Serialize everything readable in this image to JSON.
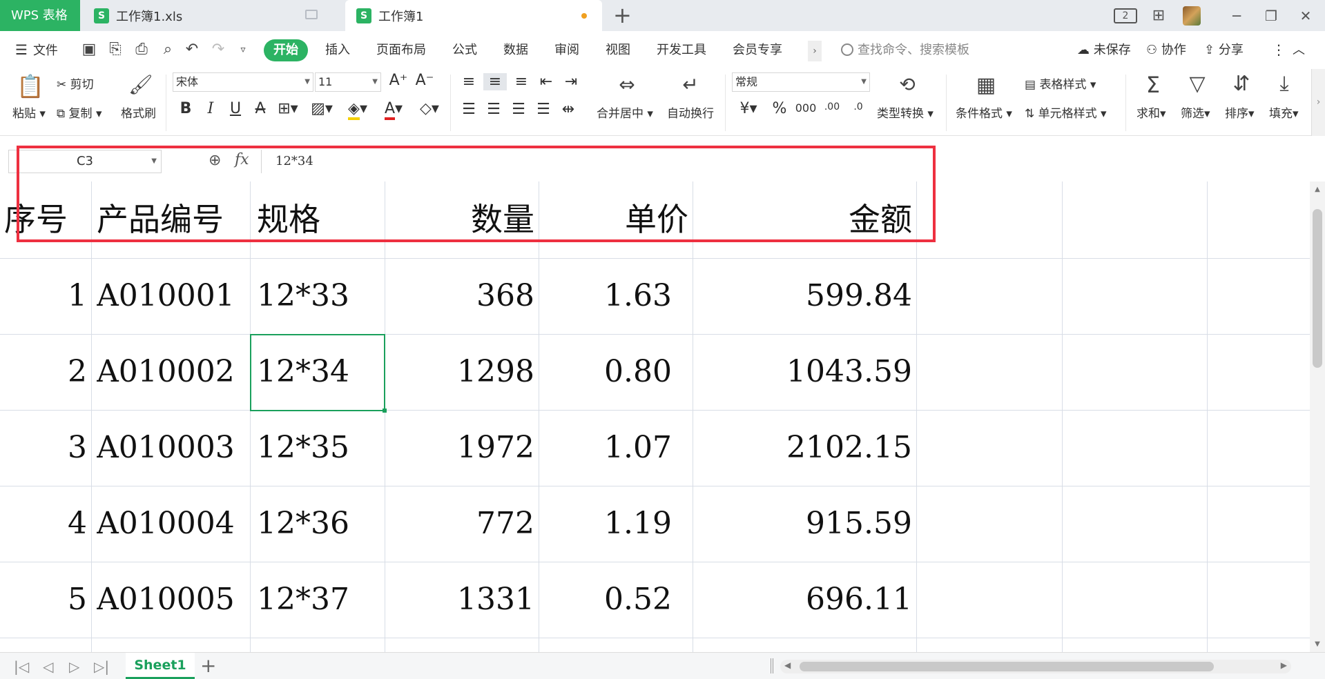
{
  "titlebar": {
    "brand": "WPS 表格",
    "tabs": [
      {
        "label": "工作簿1.xls",
        "icon": "S"
      },
      {
        "label": "工作簿1",
        "icon": "S"
      }
    ],
    "new_tab": "+",
    "layout_badge": "2"
  },
  "menu": {
    "file": "文件",
    "start": "开始",
    "items": [
      "插入",
      "页面布局",
      "公式",
      "数据",
      "审阅",
      "视图",
      "开发工具",
      "会员专享"
    ],
    "search_placeholder": "查找命令、搜索模板",
    "unsaved": "未保存",
    "collab": "协作",
    "share": "分享"
  },
  "ribbon": {
    "paste": "粘贴",
    "cut": "剪切",
    "copy": "复制",
    "format_painter": "格式刷",
    "font_name": "宋体",
    "font_size": "11",
    "merge_center": "合并居中",
    "wrap": "自动换行",
    "number_format": "常规",
    "type_convert": "类型转换",
    "cond_format": "条件格式",
    "table_style": "表格样式",
    "cell_style": "单元格样式",
    "sum": "求和",
    "filter": "筛选",
    "sort": "排序",
    "fill": "填充"
  },
  "formula_bar": {
    "name_box": "C3",
    "fx": "fx",
    "formula": "12*34"
  },
  "sheet": {
    "headers": [
      "序号",
      "产品编号",
      "规格",
      "数量",
      "单价",
      "金额"
    ],
    "rows": [
      [
        "1",
        "A010001",
        "12*33",
        "368",
        "1.63",
        "599.84"
      ],
      [
        "2",
        "A010002",
        "12*34",
        "1298",
        "0.80",
        "1043.59"
      ],
      [
        "3",
        "A010003",
        "12*35",
        "1972",
        "1.07",
        "2102.15"
      ],
      [
        "4",
        "A010004",
        "12*36",
        "772",
        "1.19",
        "915.59"
      ],
      [
        "5",
        "A010005",
        "12*37",
        "1331",
        "0.52",
        "696.11"
      ]
    ],
    "selected_cell": "C3"
  },
  "sheetbar": {
    "active_sheet": "Sheet1",
    "add": "+"
  },
  "colors": {
    "accent": "#2cb363",
    "highlight_box": "#ee3040",
    "selection": "#1aa05c"
  }
}
